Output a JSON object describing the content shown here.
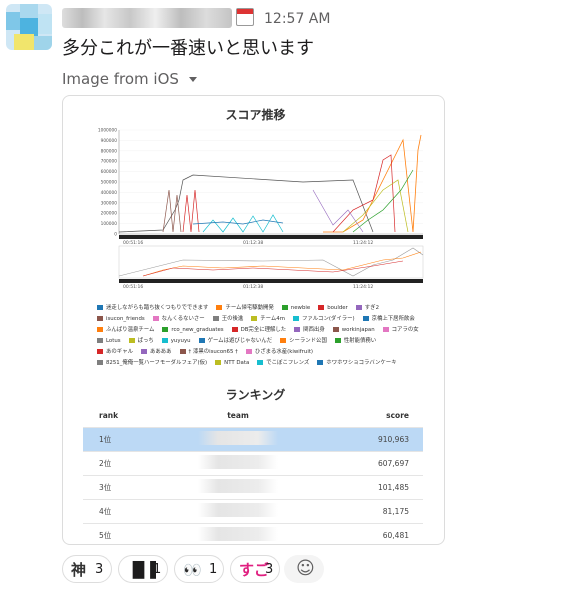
{
  "message": {
    "time": "12:57 AM",
    "text": "多分これが一番速いと思います",
    "attachment_label": "Image from iOS"
  },
  "image": {
    "chart_title": "スコア推移",
    "y_ticks": [
      "1000000",
      "900000",
      "800000",
      "700000",
      "600000",
      "500000",
      "400000",
      "300000",
      "200000",
      "100000",
      "0"
    ],
    "x_ticks": [
      "00:51:16",
      "01:12:38",
      "11:24:12"
    ],
    "legend": [
      {
        "label": "迷走しながらも踏ち抜くつもりでできます",
        "color": "#1f77b4"
      },
      {
        "label": "チーム帰宅駆動開発",
        "color": "#ff7f0e"
      },
      {
        "label": "newbie",
        "color": "#2ca02c"
      },
      {
        "label": "boulder",
        "color": "#d62728"
      },
      {
        "label": "すぎ2",
        "color": "#9467bd"
      },
      {
        "label": "isucon_friends",
        "color": "#8c564b"
      },
      {
        "label": "なんくるないさー",
        "color": "#e377c2"
      },
      {
        "label": "王の後進",
        "color": "#7f7f7f"
      },
      {
        "label": "チーム4m",
        "color": "#bcbd22"
      },
      {
        "label": "ファルコン(ダイラー)",
        "color": "#17becf"
      },
      {
        "label": "京橋上下居所飲会",
        "color": "#1f77b4"
      },
      {
        "label": "ふんばり温泉チーム",
        "color": "#ff7f0e"
      },
      {
        "label": "rco_new_graduates",
        "color": "#2ca02c"
      },
      {
        "label": "DB完全に理解した",
        "color": "#d62728"
      },
      {
        "label": "関西出身",
        "color": "#9467bd"
      },
      {
        "label": "workinjapan",
        "color": "#8c564b"
      },
      {
        "label": "コアラの女",
        "color": "#e377c2"
      },
      {
        "label": "Lotus",
        "color": "#7f7f7f"
      },
      {
        "label": "ぱっち",
        "color": "#bcbd22"
      },
      {
        "label": "yuyuyu",
        "color": "#17becf"
      },
      {
        "label": "ゲームは遊びじゃないんだ",
        "color": "#1f77b4"
      },
      {
        "label": "シーランド公国",
        "color": "#ff7f0e"
      },
      {
        "label": "性射能債務い",
        "color": "#2ca02c"
      },
      {
        "label": "あのギャル",
        "color": "#d62728"
      },
      {
        "label": "ああああ",
        "color": "#9467bd"
      },
      {
        "label": "† 漆黒のisucon65 †",
        "color": "#8c564b"
      },
      {
        "label": "ひざまる水産(kiwifruit)",
        "color": "#e377c2"
      },
      {
        "label": "8251_俺俺一覧ハーフモーダルフェア(仮)",
        "color": "#7f7f7f"
      },
      {
        "label": "NTT Data",
        "color": "#bcbd22"
      },
      {
        "label": "でこぼこフレンズ",
        "color": "#17becf"
      },
      {
        "label": "ホワホワショコラバンケーキ",
        "color": "#1f77b4"
      }
    ],
    "ranking_title": "ランキング",
    "ranking_headers": {
      "rank": "rank",
      "team": "team",
      "score": "score"
    },
    "ranking_rows": [
      {
        "rank": "1位",
        "score": "910,963"
      },
      {
        "rank": "2位",
        "score": "607,697"
      },
      {
        "rank": "3位",
        "score": "101,485"
      },
      {
        "rank": "4位",
        "score": "81,175"
      },
      {
        "rank": "5位",
        "score": "60,481"
      }
    ]
  },
  "reactions": [
    {
      "emoji": "神",
      "count": "3",
      "icon": "kami-emoji"
    },
    {
      "emoji": "▐▌▌",
      "count": "1",
      "icon": "bars-emoji"
    },
    {
      "emoji": "👀",
      "count": "1",
      "icon": "eyes-emoji"
    },
    {
      "emoji": "すご",
      "count": "3",
      "icon": "sugo-emoji"
    }
  ],
  "colors": {
    "highlight_row": "#bcd9f5",
    "reaction_text": "#1d1c1d",
    "sugo": "#e01f80"
  }
}
